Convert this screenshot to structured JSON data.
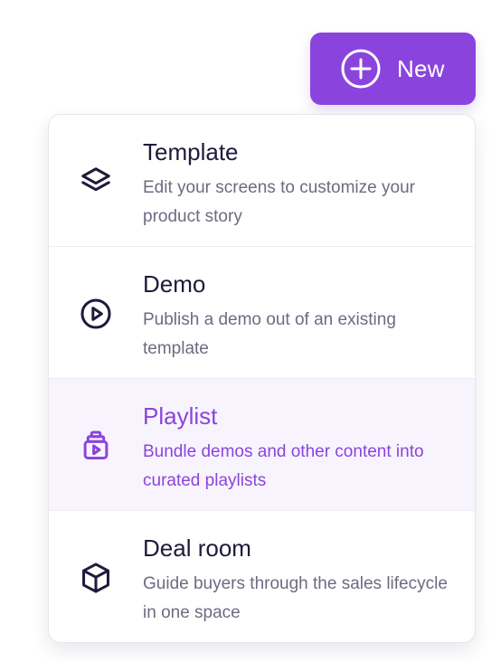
{
  "new_button": {
    "label": "New",
    "icon": "plus-circle-icon",
    "color": "#8a44dd"
  },
  "menu": {
    "items": [
      {
        "title": "Template",
        "description": "Edit your screens to customize your product story",
        "icon": "layers-icon",
        "active": false
      },
      {
        "title": "Demo",
        "description": "Publish a demo out of an existing template",
        "icon": "play-circle-icon",
        "active": false
      },
      {
        "title": "Playlist",
        "description": "Bundle demos and other content into curated playlists",
        "icon": "playlist-stack-icon",
        "active": true
      },
      {
        "title": "Deal room",
        "description": "Guide buyers through the sales lifecycle in one space",
        "icon": "cube-icon",
        "active": false
      }
    ]
  },
  "colors": {
    "accent": "#8a44dd",
    "text_dark": "#1f1a3a",
    "text_muted": "#6e6a80",
    "active_bg": "#f8f4fe"
  }
}
